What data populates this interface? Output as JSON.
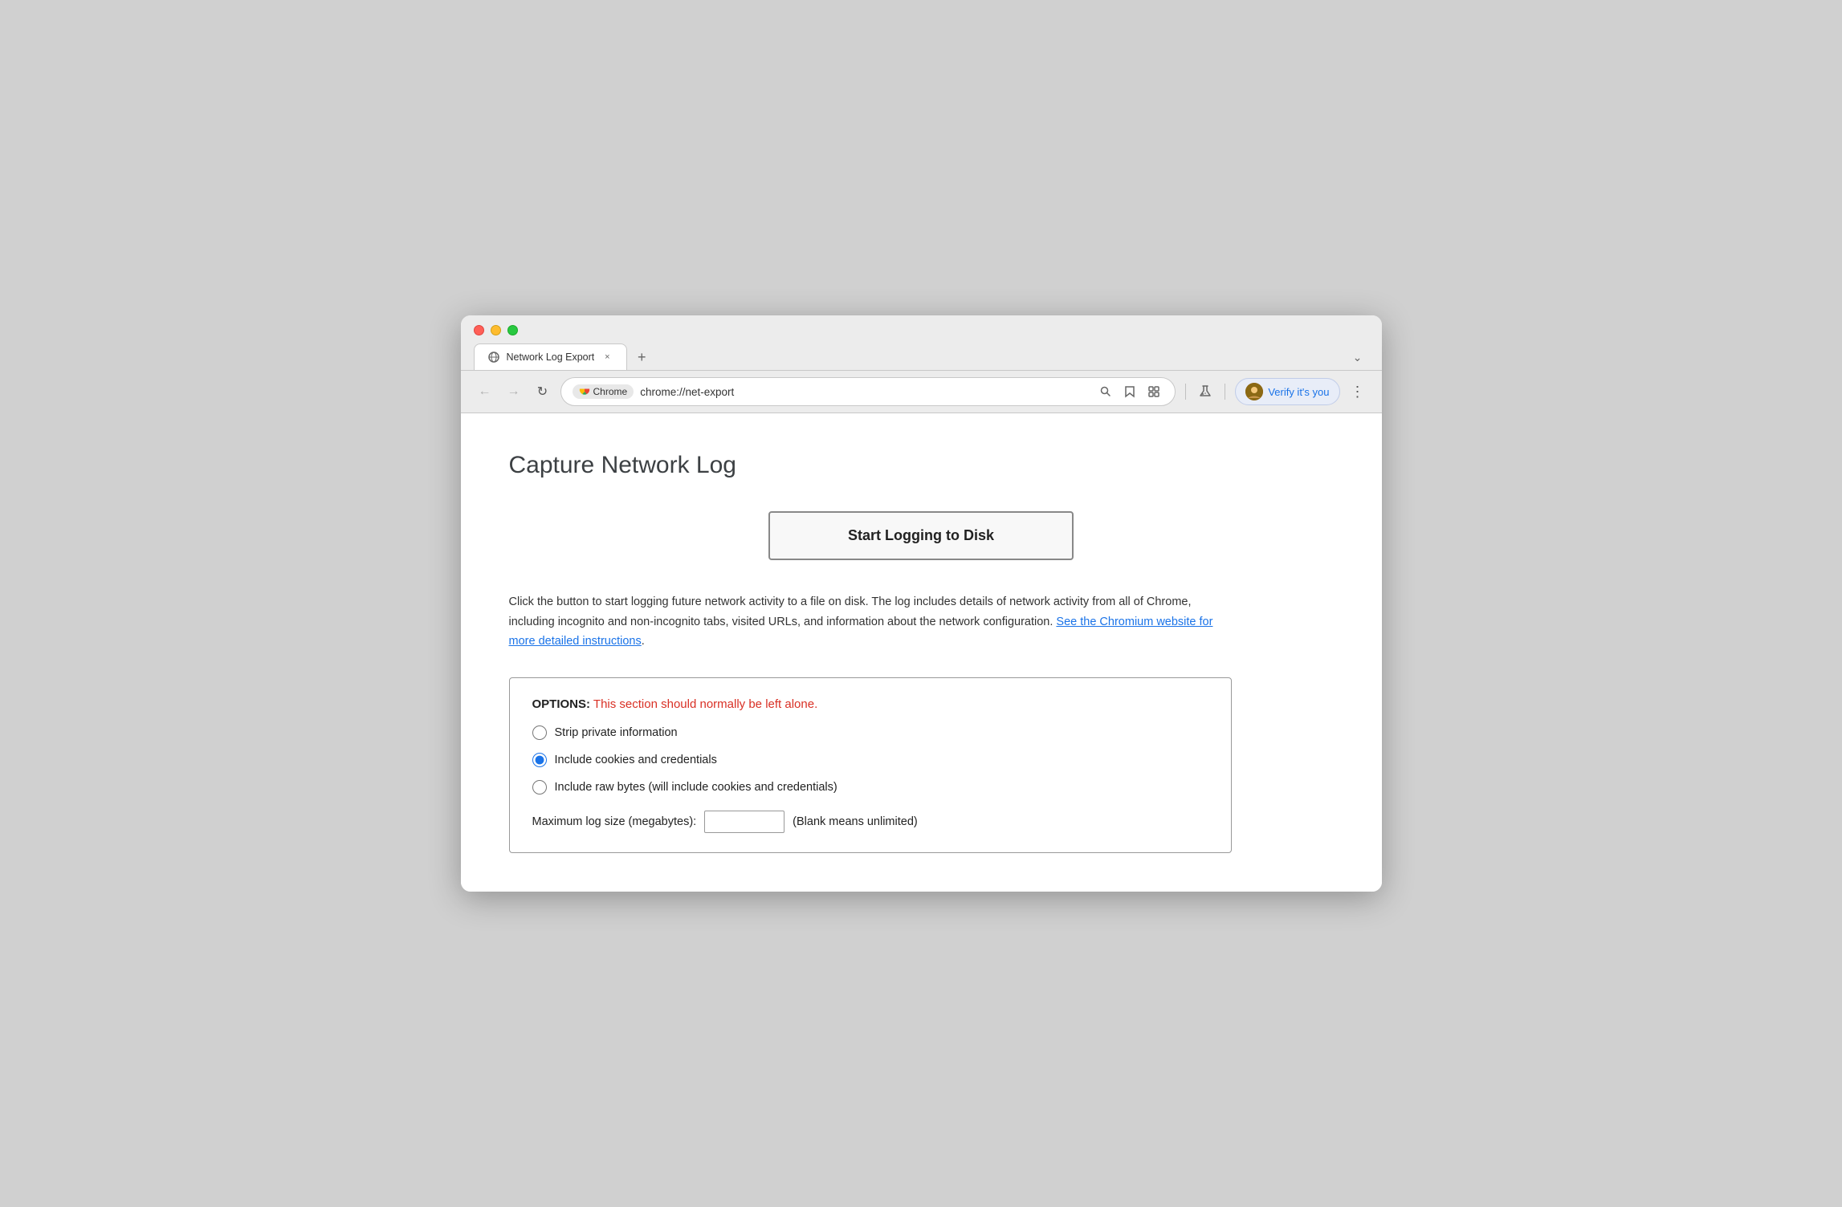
{
  "browser": {
    "tab_title": "Network Log Export",
    "tab_close_label": "×",
    "new_tab_label": "+",
    "expand_label": "⌄",
    "nav": {
      "back_label": "←",
      "forward_label": "→",
      "reload_label": "↻"
    },
    "address_bar": {
      "chrome_badge": "Chrome",
      "url": "chrome://net-export",
      "search_icon": "🔍",
      "star_icon": "☆",
      "extension_icon": "⊡",
      "lab_icon": "⚗"
    },
    "verify_btn_label": "Verify it's you",
    "menu_label": "⋮"
  },
  "page": {
    "title": "Capture Network Log",
    "start_button_label": "Start Logging to Disk",
    "description": "Click the button to start logging future network activity to a file on disk. The log includes details of network activity from all of Chrome, including incognito and non-incognito tabs, visited URLs, and information about the network configuration. ",
    "description_link_text": "See the Chromium website for more detailed instructions",
    "description_end": ".",
    "options": {
      "label": "OPTIONS:",
      "warning": " This section should normally be left alone.",
      "radio_items": [
        {
          "id": "strip",
          "label": "Strip private information",
          "checked": false
        },
        {
          "id": "cookies",
          "label": "Include cookies and credentials",
          "checked": true
        },
        {
          "id": "rawbytes",
          "label": "Include raw bytes (will include cookies and credentials)",
          "checked": false
        }
      ],
      "max_log_label": "Maximum log size (megabytes):",
      "max_log_hint": "(Blank means unlimited)",
      "max_log_value": ""
    }
  }
}
